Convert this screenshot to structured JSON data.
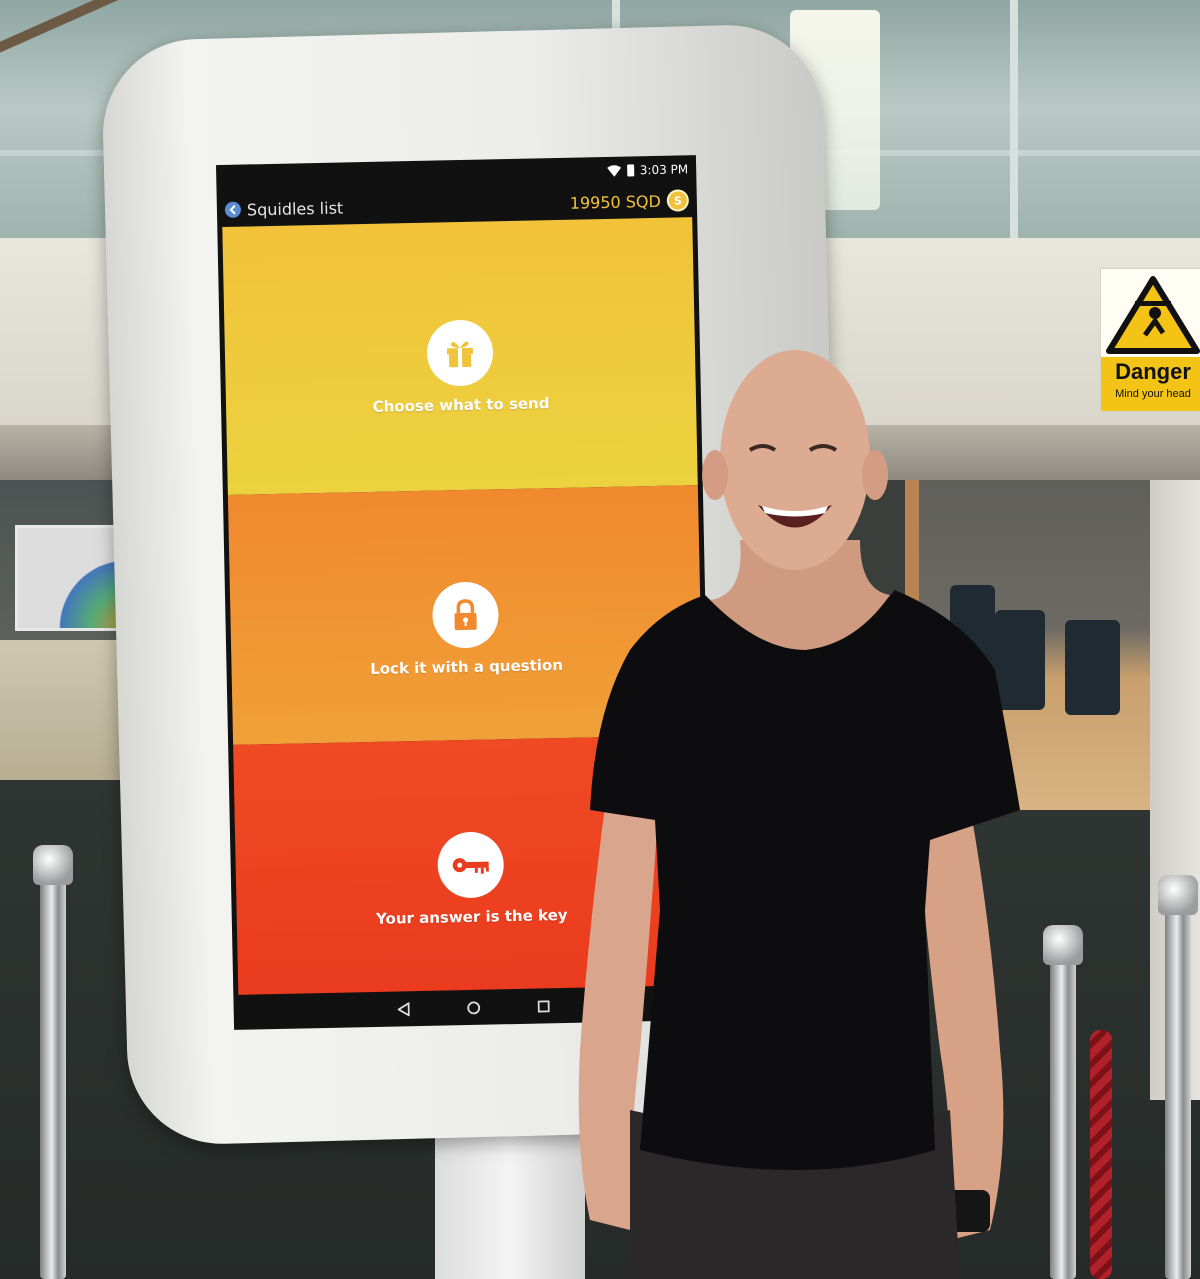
{
  "kiosk": {
    "status_bar": {
      "time": "3:03 PM",
      "icons": [
        "wifi-icon",
        "battery-icon"
      ]
    },
    "header": {
      "back_label": "Squidles list",
      "balance": "19950 SQD",
      "coin_symbol": "S"
    },
    "steps": [
      {
        "label": "Choose what to send",
        "icon": "gift-icon",
        "color": "#f1c23a"
      },
      {
        "label": "Lock it with a question",
        "icon": "padlock-icon",
        "color": "#f1892e"
      },
      {
        "label": "Your answer is the key",
        "icon": "key-icon",
        "color": "#ef4a23"
      }
    ],
    "nav": [
      "back-triangle-icon",
      "home-circle-icon",
      "recents-square-icon"
    ]
  },
  "sign": {
    "title": "Danger",
    "subtitle": "Mind your head",
    "color": "#f3c315"
  }
}
